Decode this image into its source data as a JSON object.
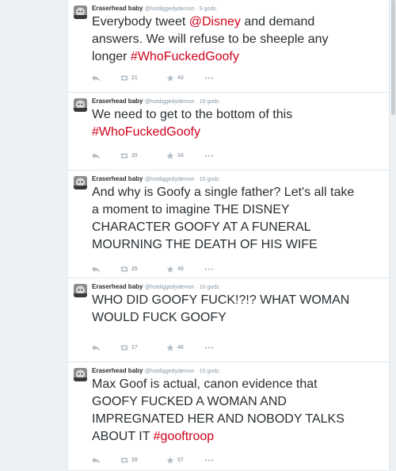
{
  "tweets": [
    {
      "name": "Eraserhead baby",
      "handle": "@hotdiggedydemon",
      "time": "9 godz.",
      "parts": [
        {
          "t": "Everybody tweet ",
          "k": "plain"
        },
        {
          "t": "@Disney",
          "k": "mention"
        },
        {
          "t": " and demand answers. We will refuse to be sheeple any longer ",
          "k": "plain"
        },
        {
          "t": "#WhoFuckedGoofy",
          "k": "tag"
        }
      ],
      "retweets": "21",
      "favorites": "43"
    },
    {
      "name": "Eraserhead baby",
      "handle": "@hotdiggedydemon",
      "time": "10 godz.",
      "parts": [
        {
          "t": "We need to get to the bottom of this ",
          "k": "plain"
        },
        {
          "t": "#WhoFuckedGoofy",
          "k": "tag"
        }
      ],
      "retweets": "20",
      "favorites": "34"
    },
    {
      "name": "Eraserhead baby",
      "handle": "@hotdiggedydemon",
      "time": "10 godz.",
      "parts": [
        {
          "t": "And why is Goofy a single father? Let's all take a moment to imagine THE DISNEY CHARACTER GOOFY AT A FUNERAL MOURNING THE DEATH OF HIS WIFE",
          "k": "plain"
        }
      ],
      "retweets": "25",
      "favorites": "49"
    },
    {
      "name": "Eraserhead baby",
      "handle": "@hotdiggedydemon",
      "time": "10 godz.",
      "parts": [
        {
          "t": "WHO DID GOOFY FUCK!?!? WHAT WOMAN WOULD FUCK GOOFY",
          "k": "plain"
        }
      ],
      "retweets": "17",
      "favorites": "46"
    },
    {
      "name": "Eraserhead baby",
      "handle": "@hotdiggedydemon",
      "time": "10 godz.",
      "parts": [
        {
          "t": "Max Goof is actual, canon evidence that GOOFY FUCKED A WOMAN AND IMPREGNATED HER AND NOBODY TALKS ABOUT IT ",
          "k": "plain"
        },
        {
          "t": "#gooftroop",
          "k": "tag"
        }
      ],
      "retweets": "28",
      "favorites": "57"
    }
  ],
  "icons": {
    "reply": "reply-icon",
    "retweet": "retweet-icon",
    "favorite": "star-icon",
    "more": "more-icon",
    "avatar": "avatar-icon"
  },
  "colors": {
    "link": "#d0021b",
    "text": "#292f33",
    "meta": "#8899a6",
    "border": "#e1e8ed"
  }
}
